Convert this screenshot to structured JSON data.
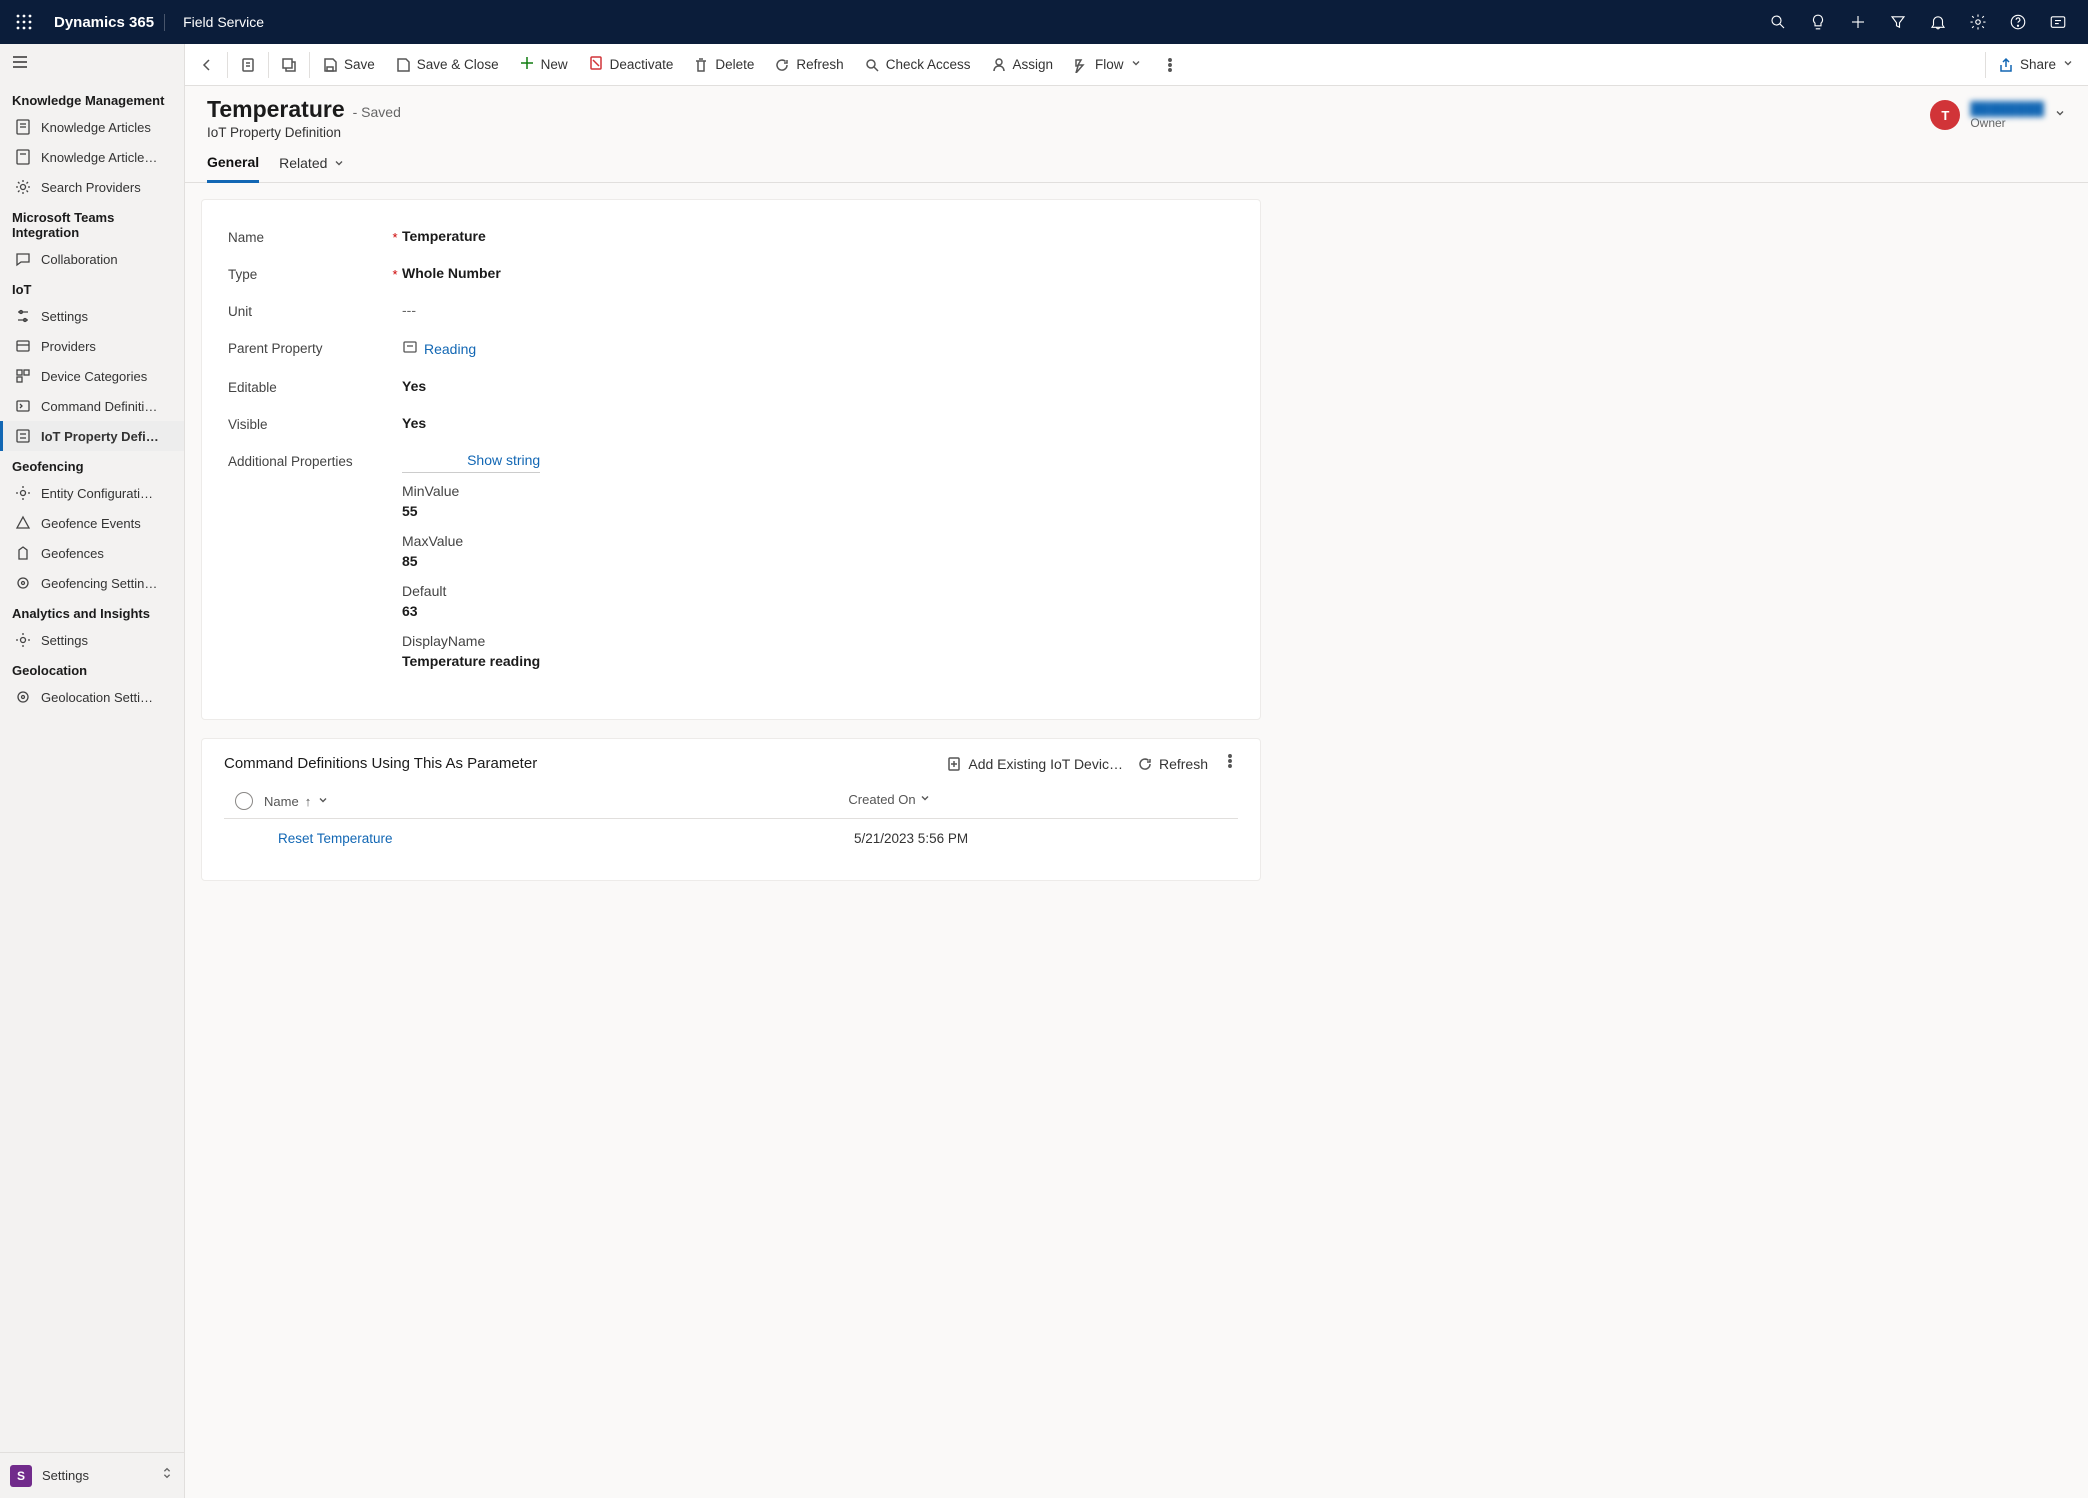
{
  "topnav": {
    "brand": "Dynamics 365",
    "module": "Field Service"
  },
  "cmdbar": {
    "save": "Save",
    "save_close": "Save & Close",
    "new": "New",
    "deactivate": "Deactivate",
    "delete": "Delete",
    "refresh": "Refresh",
    "check_access": "Check Access",
    "assign": "Assign",
    "flow": "Flow",
    "share": "Share"
  },
  "record": {
    "title": "Temperature",
    "status": "- Saved",
    "entity": "IoT Property Definition",
    "owner_initial": "T",
    "owner_name": "████████",
    "owner_role": "Owner"
  },
  "tabs": {
    "general": "General",
    "related": "Related"
  },
  "fields": {
    "name_label": "Name",
    "name_value": "Temperature",
    "type_label": "Type",
    "type_value": "Whole Number",
    "unit_label": "Unit",
    "unit_value": "---",
    "parent_label": "Parent Property",
    "parent_value": "Reading",
    "editable_label": "Editable",
    "editable_value": "Yes",
    "visible_label": "Visible",
    "visible_value": "Yes",
    "addtl_label": "Additional Properties",
    "show_string": "Show string",
    "min_label": "MinValue",
    "min_value": "55",
    "max_label": "MaxValue",
    "max_value": "85",
    "default_label": "Default",
    "default_value": "63",
    "display_label": "DisplayName",
    "display_value": "Temperature reading"
  },
  "subgrid": {
    "title": "Command Definitions Using This As Parameter",
    "add_existing": "Add Existing IoT Devic…",
    "refresh": "Refresh",
    "col_name": "Name",
    "col_created": "Created On",
    "rows": {
      "0": {
        "name": "Reset Temperature",
        "created": "5/21/2023 5:56 PM"
      }
    }
  },
  "sidebar": {
    "groups": {
      "knowledge": {
        "label": "Knowledge Management",
        "items": {
          "0": "Knowledge Articles",
          "1": "Knowledge Article…",
          "2": "Search Providers"
        }
      },
      "teams": {
        "label": "Microsoft Teams Integration",
        "items": {
          "0": "Collaboration"
        }
      },
      "iot": {
        "label": "IoT",
        "items": {
          "0": "Settings",
          "1": "Providers",
          "2": "Device Categories",
          "3": "Command Definiti…",
          "4": "IoT Property Defi…"
        }
      },
      "geofencing": {
        "label": "Geofencing",
        "items": {
          "0": "Entity Configurati…",
          "1": "Geofence Events",
          "2": "Geofences",
          "3": "Geofencing Settin…"
        }
      },
      "analytics": {
        "label": "Analytics and Insights",
        "items": {
          "0": "Settings"
        }
      },
      "geolocation": {
        "label": "Geolocation",
        "items": {
          "0": "Geolocation Setti…"
        }
      }
    },
    "area_tile": "S",
    "area_label": "Settings"
  }
}
